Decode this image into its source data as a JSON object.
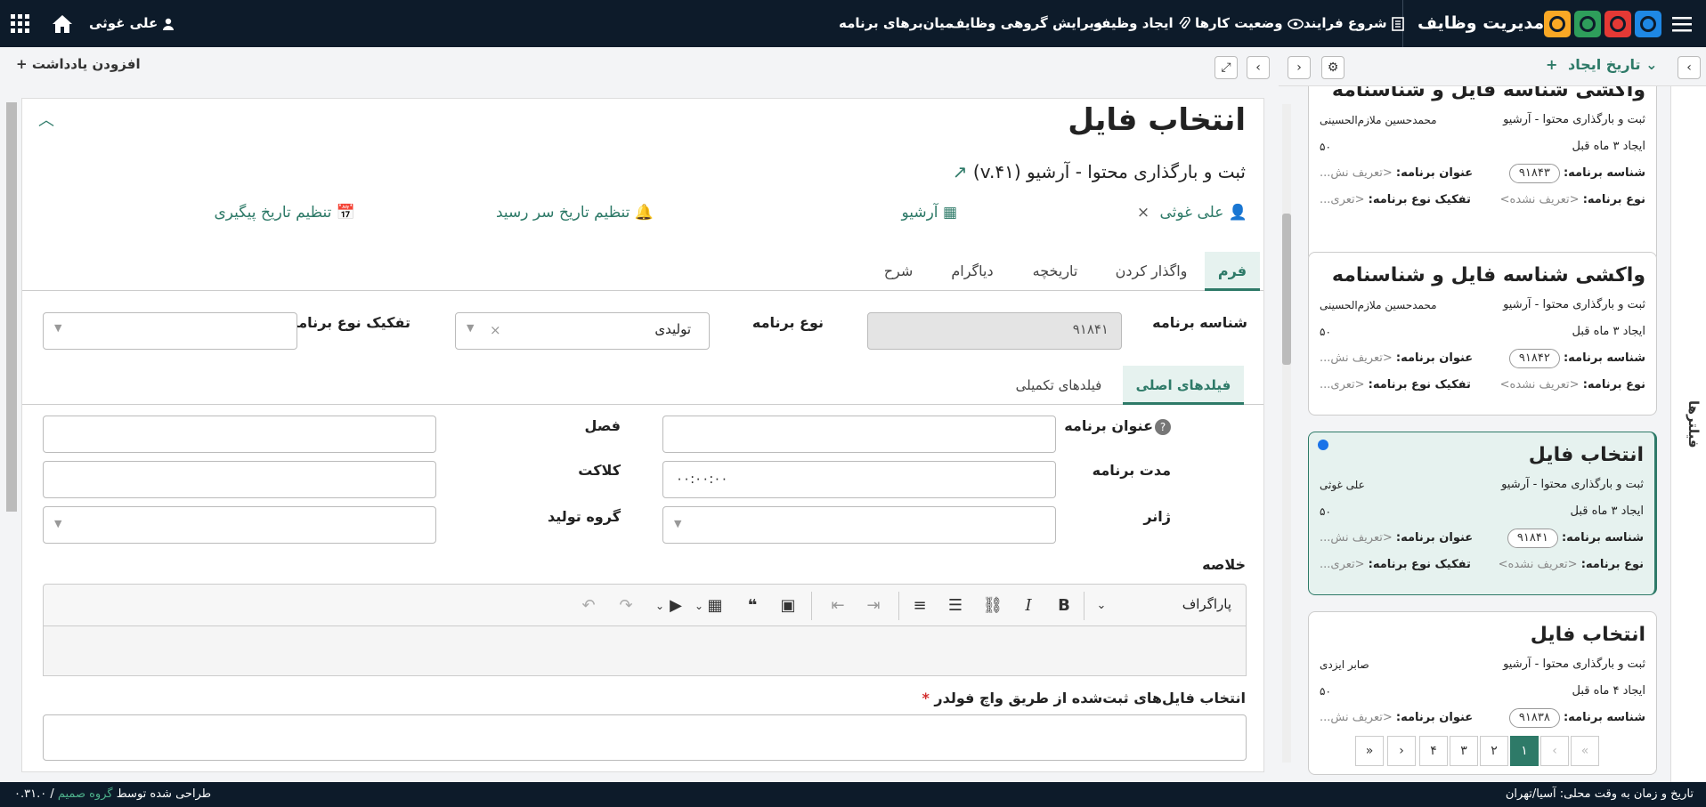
{
  "app": {
    "title": "مدیریت وظایف",
    "brand_colors": [
      "#1e88e5",
      "#e53935",
      "#2e9e5b",
      "#f9a825"
    ]
  },
  "topnav": {
    "start_process": "شروع فرایند",
    "task_status": "وضعیت کارها",
    "create_task": "ایجاد وظیفه",
    "bulk_edit": "ویرایش گروهی وظایف",
    "shortcuts": "میان‌برهای برنامه",
    "user": "علی غوثی"
  },
  "list": {
    "sort_label": "تاریخ ایجاد",
    "filters_label": "فیلترها",
    "cards": [
      {
        "title": "واکشی شناسه فایل و شناسنامه",
        "subtitle": "ثبت و بارگذاری محتوا - آرشیو",
        "assignee": "محمدحسین ملازم‌الحسینی",
        "created": "ایجاد ۳ ماه قبل",
        "priority": "۵۰",
        "id_label": "شناسه برنامه:",
        "id": "۹۱۸۴۳",
        "name_label": "عنوان برنامه:",
        "name": "<تعریف نش...",
        "type_label": "نوع برنامه:",
        "type": "<تعریف نشده>",
        "subtype_label": "تفکیک نوع برنامه:",
        "subtype": "<تعری..."
      },
      {
        "title": "واکشی شناسه فایل و شناسنامه",
        "subtitle": "ثبت و بارگذاری محتوا - آرشیو",
        "assignee": "محمدحسین ملازم‌الحسینی",
        "created": "ایجاد ۳ ماه قبل",
        "priority": "۵۰",
        "id_label": "شناسه برنامه:",
        "id": "۹۱۸۴۲",
        "name_label": "عنوان برنامه:",
        "name": "<تعریف نش...",
        "type_label": "نوع برنامه:",
        "type": "<تعریف نشده>",
        "subtype_label": "تفکیک نوع برنامه:",
        "subtype": "<تعری..."
      },
      {
        "title": "انتخاب فایل",
        "subtitle": "ثبت و بارگذاری محتوا - آرشیو",
        "assignee": "علی غوثی",
        "created": "ایجاد ۳ ماه قبل",
        "priority": "۵۰",
        "id_label": "شناسه برنامه:",
        "id": "۹۱۸۴۱",
        "name_label": "عنوان برنامه:",
        "name": "<تعریف نش...",
        "type_label": "نوع برنامه:",
        "type": "<تعریف نشده>",
        "subtype_label": "تفکیک نوع برنامه:",
        "subtype": "<تعری..."
      },
      {
        "title": "انتخاب فایل",
        "subtitle": "ثبت و بارگذاری محتوا - آرشیو",
        "assignee": "صابر ایزدی",
        "created": "ایجاد ۴ ماه قبل",
        "priority": "۵۰",
        "id_label": "شناسه برنامه:",
        "id": "۹۱۸۳۸",
        "name_label": "عنوان برنامه:",
        "name": "<تعریف نش..."
      }
    ],
    "pager": [
      "»",
      "›",
      "۴",
      "۳",
      "۲",
      "۱",
      "‹",
      "«"
    ]
  },
  "main": {
    "add_note": "افزودن یادداشت",
    "title": "انتخاب فایل",
    "subtitle": "ثبت و بارگذاری محتوا - آرشیو (v.۴۱)",
    "assignee": "علی غوثی",
    "group": "آرشیو",
    "due_date": "تنظیم تاریخ سر رسید",
    "followup_date": "تنظیم تاریخ پیگیری",
    "tabs": [
      "فرم",
      "واگذار کردن",
      "تاریخچه",
      "دیاگرام",
      "شرح"
    ],
    "form": {
      "program_id_label": "شناسه برنامه",
      "program_id": "۹۱۸۴۱",
      "program_type_label": "نوع برنامه",
      "program_type": "تولیدی",
      "program_subtype_label": "تفکیک نوع برنامه",
      "subtabs": [
        "فیلدهای اصلی",
        "فیلدهای تکمیلی"
      ],
      "title_label": "عنوان برنامه",
      "season_label": "فصل",
      "duration_label": "مدت برنامه",
      "duration": "۰۰:۰۰:۰۰",
      "clocket_label": "کلاکت",
      "genre_label": "ژانر",
      "production_group_label": "گروه تولید",
      "summary_label": "خلاصه",
      "paragraph": "پاراگراف",
      "files_label": "انتخاب فایل‌های ثبت‌شده از طریق واچ فولدر"
    }
  },
  "footer": {
    "datetime": "تاریخ و زمان به وقت محلی: آسیا/تهران",
    "designed_by": "طراحی شده توسط",
    "team": "گروه صمیم",
    "version": "/ ۰.۳۱.۰"
  }
}
